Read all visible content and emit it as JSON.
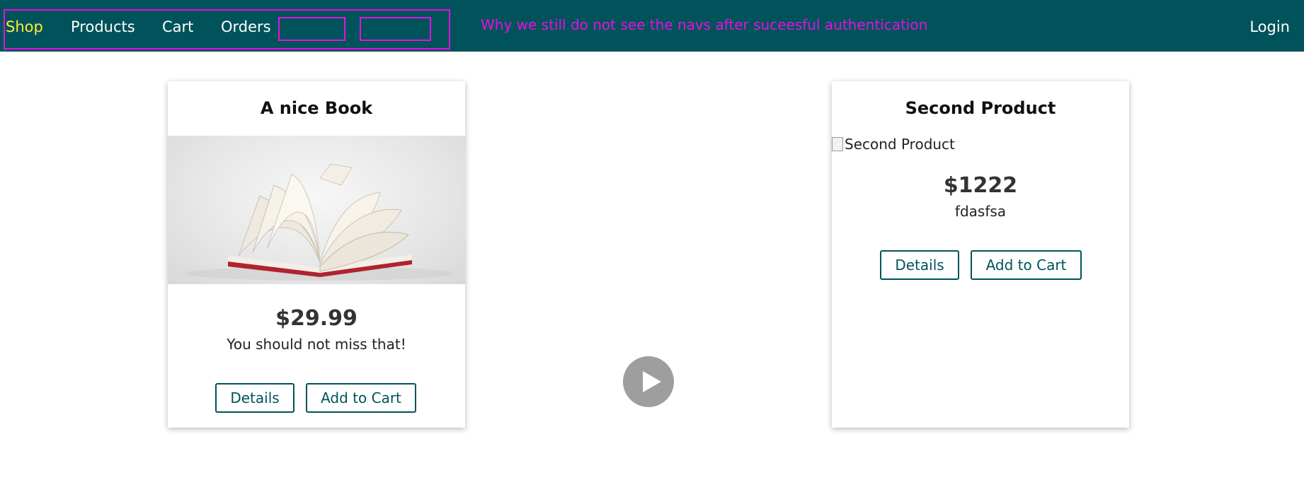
{
  "header": {
    "nav": [
      "Shop",
      "Products",
      "Cart",
      "Orders"
    ],
    "login_label": "Login",
    "annotation": "Why we still do not see the navs after suceesful authentication"
  },
  "products": [
    {
      "title": "A nice Book",
      "price": "$29.99",
      "description": "You should not miss that!",
      "image": "open-book-photo",
      "details_label": "Details",
      "add_to_cart_label": "Add to Cart"
    },
    {
      "title": "Second Product",
      "price": "$1222",
      "description": "fdasfsa",
      "image_alt": "Second Product",
      "details_label": "Details",
      "add_to_cart_label": "Add to Cart"
    }
  ],
  "colors": {
    "header_bg": "#00535a",
    "active_nav": "#ffeb3b",
    "annotation": "#e60ee6",
    "button_border": "#00535a"
  },
  "overlay": {
    "icon": "play-icon"
  }
}
